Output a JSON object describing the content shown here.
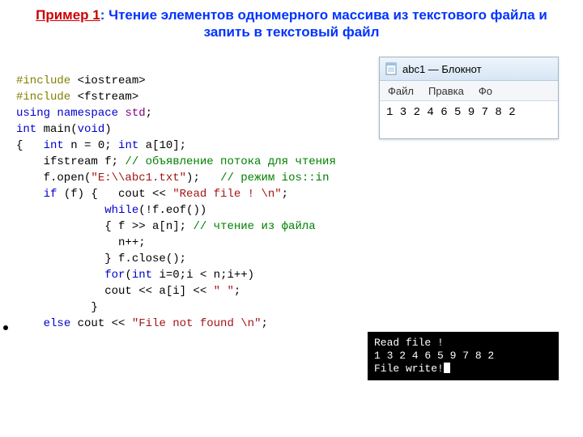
{
  "title": {
    "prefix": "Пример 1",
    "sep": ": ",
    "text": "Чтение элементов одномерного массива из текстового файла и запить в текстовый файл"
  },
  "notepad": {
    "window_title": "abc1 — Блокнот",
    "menu": {
      "file": "Файл",
      "edit": "Правка",
      "more": "Фо"
    },
    "content": "1 3 2 4 6 5 9 7 8 2"
  },
  "console": {
    "line1": "Read file !",
    "line2": "1 3 2 4 6 5 9 7 8 2",
    "line3": "File write!"
  },
  "code": {
    "l01_a": "#include ",
    "l01_b": "<iostream>",
    "l02_a": "#include ",
    "l02_b": "<fstream>",
    "l03_a": "using",
    "l03_b": " namespace ",
    "l03_c": "std",
    "l03_d": ";",
    "l04_a": "int",
    "l04_b": " main(",
    "l04_c": "void",
    "l04_d": ")",
    "l05_a": "{   ",
    "l05_b": "int",
    "l05_c": " n = 0; ",
    "l05_d": "int",
    "l05_e": " a[10];",
    "l06_a": "    ifstream f; ",
    "l06_b": "// объявление потока для чтения",
    "l07_a": "    f.open(",
    "l07_b": "\"E:\\\\abc1.txt\"",
    "l07_c": ");   ",
    "l07_d": "// режим ios::in",
    "l08_a": "    ",
    "l08_b": "if",
    "l08_c": " (f) {   cout << ",
    "l08_d": "\"Read file ! \\n\"",
    "l08_e": ";",
    "l09_a": "             ",
    "l09_b": "while",
    "l09_c": "(!f.eof())",
    "l10_a": "             { f >> a[n]; ",
    "l10_b": "// чтение из файла",
    "l11": "               n++;",
    "l12": "             } f.close();",
    "l13_a": "             ",
    "l13_b": "for",
    "l13_c": "(",
    "l13_d": "int",
    "l13_e": " i=0;i < n;i++)",
    "l14_a": "             cout << a[i] << ",
    "l14_b": "\" \"",
    "l14_c": ";",
    "l15": "           }",
    "l16_a": "    ",
    "l16_b": "else",
    "l16_c": " cout << ",
    "l16_d": "\"File not found \\n\"",
    "l16_e": ";"
  }
}
